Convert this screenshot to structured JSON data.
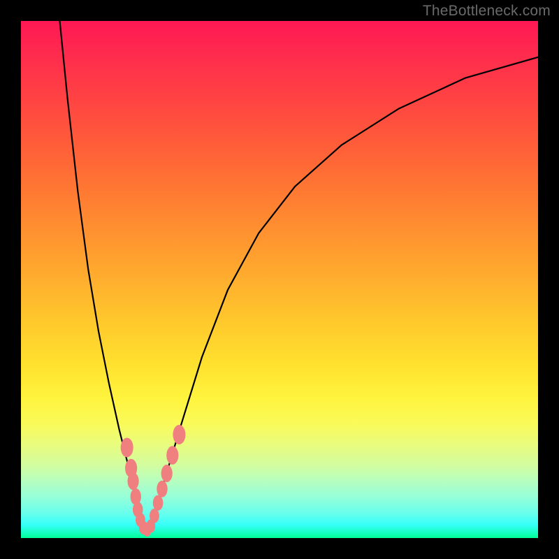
{
  "watermark_text": "TheBottleneck.com",
  "colors": {
    "frame": "#000000",
    "curve": "#000000",
    "beads": "#f08080",
    "gradient_top": "#ff1854",
    "gradient_bottom": "#00ff99"
  },
  "chart_data": {
    "type": "line",
    "title": "",
    "xlabel": "",
    "ylabel": "",
    "xlim": [
      0,
      100
    ],
    "ylim": [
      0,
      100
    ],
    "grid": false,
    "legend": null,
    "annotations": [
      "TheBottleneck.com"
    ],
    "note": "No numeric axis ticks or labels are rendered in the image; values are approximate positions read off the 740×740 plot area in percent coordinates (0,0 bottom-left → 100,100 top-right).",
    "series": [
      {
        "name": "left-branch",
        "x": [
          7.5,
          9,
          11,
          13,
          15,
          17,
          19,
          21,
          22.5,
          23.7
        ],
        "y": [
          100,
          85,
          67,
          52,
          40,
          30,
          21,
          13,
          7,
          2
        ]
      },
      {
        "name": "right-branch",
        "x": [
          24.5,
          26,
          28,
          31,
          35,
          40,
          46,
          53,
          62,
          73,
          86,
          100
        ],
        "y": [
          1.5,
          5,
          12,
          22,
          35,
          48,
          59,
          68,
          76,
          83,
          89,
          93
        ]
      }
    ],
    "highlight_points": {
      "name": "beads-near-vertex",
      "points": [
        {
          "x": 20.5,
          "y": 17.5
        },
        {
          "x": 21.3,
          "y": 13.5
        },
        {
          "x": 21.7,
          "y": 11
        },
        {
          "x": 22.2,
          "y": 8
        },
        {
          "x": 22.6,
          "y": 5.5
        },
        {
          "x": 23.1,
          "y": 3.5
        },
        {
          "x": 23.7,
          "y": 2
        },
        {
          "x": 24.4,
          "y": 1.5
        },
        {
          "x": 25.1,
          "y": 2.3
        },
        {
          "x": 25.8,
          "y": 4.3
        },
        {
          "x": 26.5,
          "y": 6.8
        },
        {
          "x": 27.3,
          "y": 9.5
        },
        {
          "x": 28.2,
          "y": 12.5
        },
        {
          "x": 29.3,
          "y": 16
        },
        {
          "x": 30.6,
          "y": 20
        }
      ]
    }
  }
}
